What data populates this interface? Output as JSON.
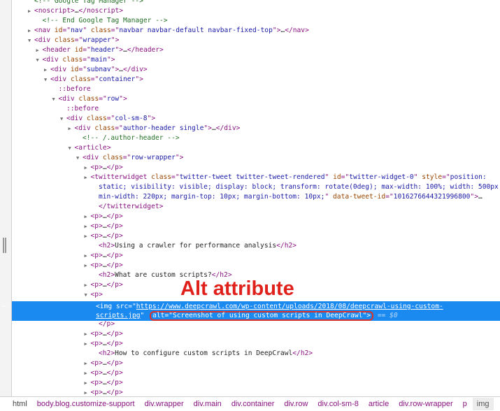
{
  "colors": {
    "tag": "#881280",
    "attr_name": "#994500",
    "attr_value": "#1a1aa6",
    "comment": "#236e25",
    "selection": "#1a89f0",
    "annotation": "#e0201a"
  },
  "tree": {
    "lines": [
      {
        "id": "l0",
        "indent": 2,
        "toggle": "",
        "text": "<!-- Google Tag Manager -->"
      },
      {
        "id": "l1",
        "indent": 2,
        "toggle": "collapsed",
        "open": "<noscript>",
        "ellipsis": "…",
        "close": "</noscript>"
      },
      {
        "id": "l2",
        "indent": 3,
        "toggle": "",
        "comment": "<!-- End Google Tag Manager -->"
      },
      {
        "id": "l3",
        "indent": 2,
        "toggle": "collapsed",
        "tag": "nav",
        "attrs": [
          {
            "n": "id",
            "v": "nav"
          },
          {
            "n": "class",
            "v": "navbar navbar-default navbar-fixed-top"
          }
        ],
        "ellipsis": "…",
        "close": "</nav>"
      },
      {
        "id": "l4",
        "indent": 2,
        "toggle": "expanded",
        "tag": "div",
        "attrs": [
          {
            "n": "class",
            "v": "wrapper"
          }
        ]
      },
      {
        "id": "l5",
        "indent": 3,
        "toggle": "collapsed",
        "tag": "header",
        "attrs": [
          {
            "n": "id",
            "v": "header"
          }
        ],
        "ellipsis": "…",
        "close": "</header>"
      },
      {
        "id": "l6",
        "indent": 3,
        "toggle": "expanded",
        "tag": "div",
        "attrs": [
          {
            "n": "class",
            "v": "main"
          }
        ]
      },
      {
        "id": "l7",
        "indent": 4,
        "toggle": "collapsed",
        "tag": "div",
        "attrs": [
          {
            "n": "id",
            "v": "subnav"
          }
        ],
        "ellipsis": "…",
        "close": "</div>"
      },
      {
        "id": "l8",
        "indent": 4,
        "toggle": "expanded",
        "tag": "div",
        "attrs": [
          {
            "n": "class",
            "v": "container"
          }
        ]
      },
      {
        "id": "l9",
        "indent": 5,
        "toggle": "",
        "pseudo": "::before"
      },
      {
        "id": "l10",
        "indent": 5,
        "toggle": "expanded",
        "tag": "div",
        "attrs": [
          {
            "n": "class",
            "v": "row"
          }
        ]
      },
      {
        "id": "l11",
        "indent": 6,
        "toggle": "",
        "pseudo": "::before"
      },
      {
        "id": "l12",
        "indent": 6,
        "toggle": "expanded",
        "tag": "div",
        "attrs": [
          {
            "n": "class",
            "v": "col-sm-8"
          }
        ]
      },
      {
        "id": "l13",
        "indent": 7,
        "toggle": "collapsed",
        "tag": "div",
        "attrs": [
          {
            "n": "class",
            "v": "author-header single"
          }
        ],
        "ellipsis": "…",
        "close": "</div>"
      },
      {
        "id": "l14",
        "indent": 8,
        "toggle": "",
        "comment": "<!-- /.author-header -->"
      },
      {
        "id": "l15",
        "indent": 7,
        "toggle": "expanded",
        "tag": "article",
        "attrs": []
      },
      {
        "id": "l16",
        "indent": 8,
        "toggle": "expanded",
        "tag": "div",
        "attrs": [
          {
            "n": "class",
            "v": "row-wrapper"
          }
        ]
      },
      {
        "id": "l17",
        "indent": 9,
        "toggle": "collapsed",
        "tag": "p",
        "attrs": [],
        "ellipsis": "…",
        "close": "</p>"
      },
      {
        "id": "l18",
        "indent": 9,
        "toggle": "collapsed",
        "tag": "twitterwidget",
        "attrs": [
          {
            "n": "class",
            "v": "twitter-tweet twitter-tweet-rendered"
          },
          {
            "n": "id",
            "v": "twitter-widget-0"
          },
          {
            "n": "style",
            "v": "position:"
          }
        ]
      },
      {
        "id": "l19",
        "indent": 10,
        "toggle": "",
        "raw_value": "static; visibility: visible; display: block; transform: rotate(0deg); max-width: 100%; width: 500px;"
      },
      {
        "id": "l20",
        "indent": 10,
        "toggle": "",
        "raw_value": "min-width: 220px; margin-top: 10px; margin-bottom: 10px;",
        "after_attrs": [
          {
            "n": "data-tweet-id",
            "v": "1016276644321996800"
          }
        ],
        "ellipsis": "…"
      },
      {
        "id": "l21",
        "indent": 10,
        "toggle": "",
        "close_only": "</twitterwidget>"
      },
      {
        "id": "l22",
        "indent": 9,
        "toggle": "collapsed",
        "tag": "p",
        "attrs": [],
        "ellipsis": "…",
        "close": "</p>"
      },
      {
        "id": "l23",
        "indent": 9,
        "toggle": "collapsed",
        "tag": "p",
        "attrs": [],
        "ellipsis": "…",
        "close": "</p>"
      },
      {
        "id": "l24",
        "indent": 9,
        "toggle": "collapsed",
        "tag": "p",
        "attrs": [],
        "ellipsis": "…",
        "close": "</p>"
      },
      {
        "id": "l25",
        "indent": 10,
        "toggle": "",
        "tag": "h2",
        "attrs": [],
        "inner": "Using a crawler for performance analysis",
        "close": "</h2>"
      },
      {
        "id": "l26",
        "indent": 9,
        "toggle": "collapsed",
        "tag": "p",
        "attrs": [],
        "ellipsis": "…",
        "close": "</p>"
      },
      {
        "id": "l27",
        "indent": 9,
        "toggle": "collapsed",
        "tag": "p",
        "attrs": [],
        "ellipsis": "…",
        "close": "</p>"
      },
      {
        "id": "l28",
        "indent": 10,
        "toggle": "",
        "tag": "h2",
        "attrs": [],
        "inner": "What are custom scripts?",
        "close": "</h2>"
      },
      {
        "id": "l29",
        "indent": 9,
        "toggle": "collapsed",
        "tag": "p",
        "attrs": [],
        "ellipsis": "…",
        "close": "</p>"
      },
      {
        "id": "l30",
        "indent": 9,
        "toggle": "expanded",
        "tag": "p",
        "attrs": []
      },
      {
        "id": "gap1",
        "indent": 0,
        "toggle": "",
        "spacer": true
      },
      {
        "id": "gap2",
        "indent": 0,
        "toggle": "",
        "spacer": true
      },
      {
        "id": "l33",
        "indent": 10,
        "toggle": "",
        "close_only": "</p>"
      },
      {
        "id": "l34",
        "indent": 9,
        "toggle": "collapsed",
        "tag": "p",
        "attrs": [],
        "ellipsis": "…",
        "close": "</p>"
      },
      {
        "id": "l35",
        "indent": 9,
        "toggle": "collapsed",
        "tag": "p",
        "attrs": [],
        "ellipsis": "…",
        "close": "</p>"
      },
      {
        "id": "l36",
        "indent": 10,
        "toggle": "",
        "tag": "h2",
        "attrs": [],
        "inner": "How to configure custom scripts in DeepCrawl",
        "close": "</h2>"
      },
      {
        "id": "l37",
        "indent": 9,
        "toggle": "collapsed",
        "tag": "p",
        "attrs": [],
        "ellipsis": "…",
        "close": "</p>"
      },
      {
        "id": "l38",
        "indent": 9,
        "toggle": "collapsed",
        "tag": "p",
        "attrs": [],
        "ellipsis": "…",
        "close": "</p>"
      },
      {
        "id": "l39",
        "indent": 9,
        "toggle": "collapsed",
        "tag": "p",
        "attrs": [],
        "ellipsis": "…",
        "close": "</p>"
      },
      {
        "id": "l40",
        "indent": 9,
        "toggle": "collapsed",
        "tag": "p",
        "attrs": [],
        "ellipsis": "…",
        "close": "</p>"
      }
    ]
  },
  "selected_node": {
    "dots": "…",
    "open": "<img ",
    "src_name": "src",
    "src_value_line1": "https://www.deepcrawl.com/wp-content/uploads/2018/08/deepcrawl-using-custom-",
    "src_value_line2": "scripts.jpg",
    "alt_name": "alt",
    "alt_value": "Screenshot of using custom scripts in DeepCrawl",
    "close": ">",
    "console_ref": "== $0"
  },
  "annotation": {
    "label": "Alt attribute"
  },
  "breadcrumbs": [
    "html",
    "body.blog.customize-support",
    "div.wrapper",
    "div.main",
    "div.container",
    "div.row",
    "div.col-sm-8",
    "article",
    "div.row-wrapper",
    "p",
    "img"
  ],
  "breadcrumbs_active_index": 10
}
